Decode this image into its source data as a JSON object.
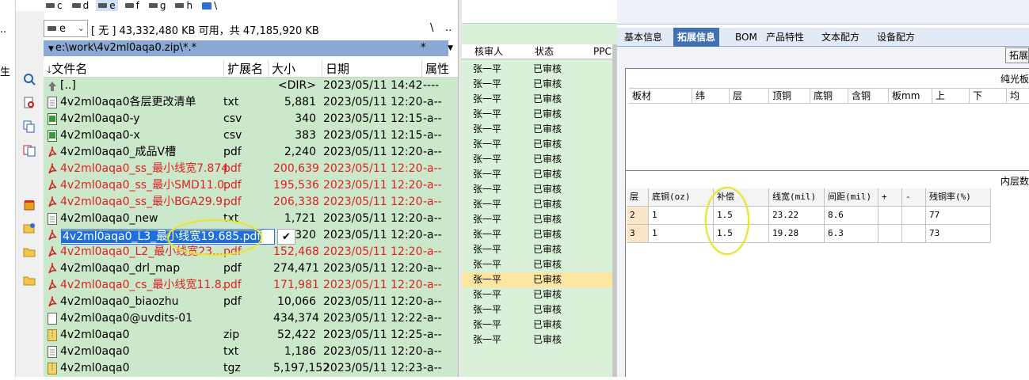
{
  "drives": [
    {
      "label": "c",
      "selected": false
    },
    {
      "label": "d",
      "selected": false
    },
    {
      "label": "e",
      "selected": true
    },
    {
      "label": "f",
      "selected": false
    },
    {
      "label": "g",
      "selected": false
    },
    {
      "label": "h",
      "selected": false
    },
    {
      "label": "\\",
      "selected": false
    }
  ],
  "left_strip": {
    "top": "..",
    "mid": "生"
  },
  "drive_select": {
    "value": "e"
  },
  "free_space": "[ 无 ]  43,332,480 KB 可用，共 47,185,920 KB",
  "nav": {
    "backslash": "\\",
    "updir": ".."
  },
  "current_path": "e:\\work\\4v2ml0aqa0.zip\\*.*",
  "filter": "*",
  "columns": {
    "name": "文件名",
    "ext": "扩展名",
    "size": "大小",
    "date": "日期",
    "attr": "属性"
  },
  "files": [
    {
      "name": "[..]",
      "ext": "",
      "size": "<DIR>",
      "date": "2023/05/11 14:42",
      "attr": "----",
      "icon": "up-folder-icon",
      "red": false
    },
    {
      "name": "4v2ml0aqa0各层更改清单",
      "ext": "txt",
      "size": "5,881",
      "date": "2023/05/11 12:20",
      "attr": "-a--",
      "icon": "txt-file-icon",
      "red": false
    },
    {
      "name": "4v2ml0aqa0-y",
      "ext": "csv",
      "size": "340",
      "date": "2023/05/11 12:15",
      "attr": "-a--",
      "icon": "csv-file-icon",
      "red": false
    },
    {
      "name": "4v2ml0aqa0-x",
      "ext": "csv",
      "size": "383",
      "date": "2023/05/11 12:15",
      "attr": "-a--",
      "icon": "csv-file-icon",
      "red": false
    },
    {
      "name": "4v2ml0aqa0_成品V槽",
      "ext": "pdf",
      "size": "2,240",
      "date": "2023/05/11 12:20",
      "attr": "-a--",
      "icon": "pdf-file-icon",
      "red": false
    },
    {
      "name": "4v2ml0aqa0_ss_最小线宽7.874",
      "ext": "pdf",
      "size": "200,639",
      "date": "2023/05/11 12:20",
      "attr": "-a--",
      "icon": "pdf-file-icon",
      "red": true
    },
    {
      "name": "4v2ml0aqa0_ss_最小SMD11.0..",
      "ext": "pdf",
      "size": "195,536",
      "date": "2023/05/11 12:20",
      "attr": "-a--",
      "icon": "pdf-file-icon",
      "red": true
    },
    {
      "name": "4v2ml0aqa0_ss_最小BGA29.9..",
      "ext": "pdf",
      "size": "206,338",
      "date": "2023/05/11 12:20",
      "attr": "-a--",
      "icon": "pdf-file-icon",
      "red": true
    },
    {
      "name": "4v2ml0aqa0_new",
      "ext": "txt",
      "size": "1,721",
      "date": "2023/05/11 12:20",
      "attr": "-a--",
      "icon": "txt-file-icon",
      "red": false
    },
    {
      "name": "",
      "ext": "",
      "size": "320",
      "date": "2023/05/11 12:20",
      "attr": "-a--",
      "icon": "pdf-file-icon",
      "red": false
    },
    {
      "name": "4v2ml0aqa0_L2_最小线宽23....",
      "ext": "pdf",
      "size": "152,468",
      "date": "2023/05/11 12:20",
      "attr": "-a--",
      "icon": "pdf-file-icon",
      "red": true
    },
    {
      "name": "4v2ml0aqa0_drl_map",
      "ext": "pdf",
      "size": "274,471",
      "date": "2023/05/11 12:20",
      "attr": "-a--",
      "icon": "pdf-file-icon",
      "red": false
    },
    {
      "name": "4v2ml0aqa0_cs_最小线宽11.8..",
      "ext": "pdf",
      "size": "171,981",
      "date": "2023/05/11 12:20",
      "attr": "-a--",
      "icon": "pdf-file-icon",
      "red": true
    },
    {
      "name": "4v2ml0aqa0_biaozhu",
      "ext": "pdf",
      "size": "10,066",
      "date": "2023/05/11 12:20",
      "attr": "-a--",
      "icon": "pdf-file-icon",
      "red": false
    },
    {
      "name": "4v2ml0aqa0@uvdits-01",
      "ext": "",
      "size": "434,374",
      "date": "2023/05/11 12:22",
      "attr": "-a--",
      "icon": "file-icon",
      "red": false
    },
    {
      "name": "4v2ml0aqa0",
      "ext": "zip",
      "size": "52,422",
      "date": "2023/05/11 12:25",
      "attr": "-a--",
      "icon": "zip-file-icon",
      "red": false
    },
    {
      "name": "4v2ml0aqa0",
      "ext": "txt",
      "size": "1,186",
      "date": "2023/05/11 12:20",
      "attr": "-a--",
      "icon": "txt-file-icon",
      "red": false
    },
    {
      "name": "4v2ml0aqa0",
      "ext": "tgz",
      "size": "5,197,152",
      "date": "2023/05/11 12:23",
      "attr": "-a--",
      "icon": "zip-file-icon",
      "red": false
    }
  ],
  "rename_value": "4v2ml0aqa0_L3_最小线宽19.685.pdf",
  "rename_confirm": "✔",
  "mid_panel": {
    "headers": {
      "reviewer": "核审人",
      "status": "状态",
      "ppc": "PPC"
    },
    "rows_reviewer": "张一平",
    "rows_status": "已审核",
    "row_count": 19,
    "highlight_row": 14
  },
  "tabs": [
    "基本信息",
    "拓展信息",
    "BOM",
    "产品特性",
    "文本配方",
    "设备配方"
  ],
  "active_tab": 1,
  "extend_button": "拓展",
  "group1": {
    "title": "纯光板",
    "headers": [
      "板材",
      "纬",
      "层",
      "顶铜",
      "底铜",
      "含铜",
      "板mm",
      "上",
      "下",
      "均"
    ]
  },
  "group2": {
    "title": "内层数",
    "headers": [
      "层",
      "底铜(oz)",
      "补偿",
      "线宽(mil)",
      "间距(mil)",
      "+",
      "-",
      "残铜率(%)"
    ],
    "rows": [
      [
        "2",
        "1",
        "1.5",
        "23.22",
        "8.6",
        "",
        "",
        "77"
      ],
      [
        "3",
        "1",
        "1.5",
        "19.28",
        "6.3",
        "",
        "",
        "73"
      ]
    ]
  },
  "colors": {
    "file_bg": "#cbe8cb",
    "red_text": "#e02020",
    "tab_active": "#3f71b4",
    "highlight_ellipse": "#e6e236",
    "selection": "#1e6fd9"
  }
}
